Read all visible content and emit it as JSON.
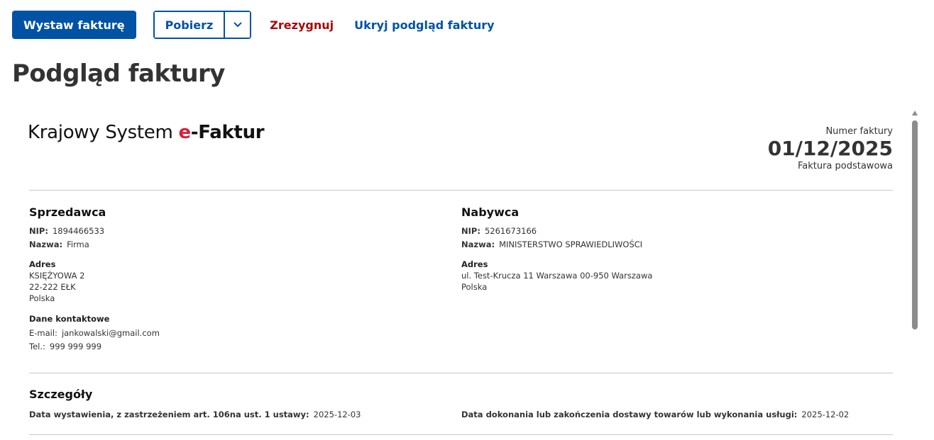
{
  "toolbar": {
    "issue_label": "Wystaw fakturę",
    "download_label": "Pobierz",
    "cancel_label": "Zrezygnuj",
    "hide_preview_label": "Ukryj podgląd faktury"
  },
  "page": {
    "title": "Podgląd faktury"
  },
  "invoice": {
    "logo": {
      "prefix": "Krajowy System ",
      "e": "e",
      "suffix": "-Faktur"
    },
    "number_label": "Numer faktury",
    "number": "01/12/2025",
    "type": "Faktura podstawowa",
    "seller": {
      "title": "Sprzedawca",
      "nip_label": "NIP:",
      "nip": "1894466533",
      "name_label": "Nazwa:",
      "name": "Firma",
      "address_label": "Adres",
      "address_lines": [
        "KSIĘŻYOWA 2",
        "22-222 EŁK",
        "Polska"
      ],
      "contact_label": "Dane kontaktowe",
      "email_label": "E-mail:",
      "email": "jankowalski@gmail.com",
      "phone_label": "Tel.:",
      "phone": "999 999 999"
    },
    "buyer": {
      "title": "Nabywca",
      "nip_label": "NIP:",
      "nip": "5261673166",
      "name_label": "Nazwa:",
      "name": "MINISTERSTWO SPRAWIEDLIWOŚCI",
      "address_label": "Adres",
      "address_lines": [
        "ul. Test-Krucza 11 Warszawa 00-950 Warszawa",
        "Polska"
      ]
    },
    "details": {
      "title": "Szczegóły",
      "issue_date_label": "Data wystawienia, z zastrzeżeniem art. 106na ust. 1 ustawy:",
      "issue_date": "2025-12-03",
      "delivery_date_label": "Data dokonania lub zakończenia dostawy towarów lub wykonania usługi:",
      "delivery_date": "2025-12-02"
    }
  },
  "colors": {
    "primary": "#0052a5",
    "danger": "#a40b0b",
    "logo_accent": "#d81e3a"
  },
  "icons": {
    "download_menu": "chevron-down-icon"
  }
}
